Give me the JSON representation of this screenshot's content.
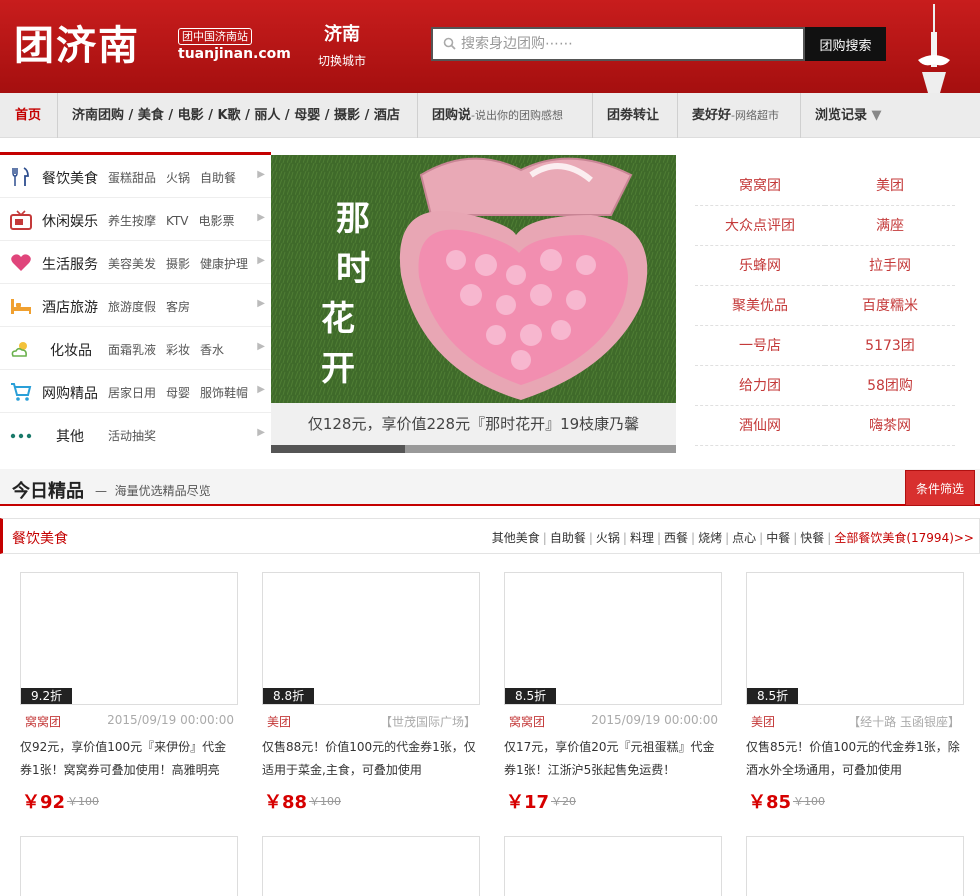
{
  "header": {
    "logo": "团济南",
    "logo_tag": "团中国济南站",
    "logo_domain": "tuanjinan.com",
    "city_name": "济南",
    "city_switch": "切换城市",
    "search_placeholder": "搜索身边团购⋯⋯",
    "search_button": "团购搜索"
  },
  "nav": {
    "home": "首页",
    "jinan_group": "济南团购",
    "food": "美食",
    "movie": "电影",
    "ktv": "K歌",
    "beauty": "丽人",
    "baby": "母婴",
    "photo": "摄影",
    "hotel": "酒店",
    "tuan_say": "团购说",
    "tuan_say_sub": "-说出你的团购感想",
    "coupon_transfer": "团劵转让",
    "maihaohao": "麦好好",
    "maihaohao_sub": "-网络超市",
    "history": "浏览记录"
  },
  "categories": [
    {
      "name": "餐饮美食",
      "links": [
        "蛋糕甜品",
        "火锅",
        "自助餐"
      ]
    },
    {
      "name": "休闲娱乐",
      "links": [
        "养生按摩",
        "KTV",
        "电影票"
      ]
    },
    {
      "name": "生活服务",
      "links": [
        "美容美发",
        "摄影",
        "健康护理"
      ]
    },
    {
      "name": "酒店旅游",
      "links": [
        "旅游度假",
        "客房"
      ]
    },
    {
      "name": "化妆品",
      "links": [
        "面霜乳液",
        "彩妆",
        "香水"
      ]
    },
    {
      "name": "网购精品",
      "links": [
        "居家日用",
        "母婴",
        "服饰鞋帽"
      ]
    },
    {
      "name": "其他",
      "links": [
        "活动抽奖"
      ]
    }
  ],
  "banner": {
    "art_text": "那时花开",
    "caption": "仅128元，享价值228元『那时花开』19枝康乃馨",
    "progress": 0.33
  },
  "sites": [
    "窝窝团",
    "美团",
    "大众点评团",
    "满座",
    "乐蜂网",
    "拉手网",
    "聚美优品",
    "百度糯米",
    "一号店",
    "5173团",
    "给力团",
    "58团购",
    "酒仙网",
    "嗨茶网"
  ],
  "today": {
    "title": "今日精品",
    "subtitle": "海量优选精品尽览",
    "filter_button": "条件筛选"
  },
  "section": {
    "title": "餐饮美食",
    "links": [
      "其他美食",
      "自助餐",
      "火锅",
      "料理",
      "西餐",
      "烧烤",
      "点心",
      "中餐",
      "快餐"
    ],
    "all_link": "全部餐饮美食(17994)>>"
  },
  "deals": [
    {
      "discount": "9.2折",
      "site": "窝窝团",
      "meta": "2015/09/19 00:00:00",
      "desc": "仅92元，享价值100元『来伊份』代金券1张！窝窝券可叠加使用！高雅明亮",
      "price": "￥92",
      "orig": "￥100"
    },
    {
      "discount": "8.8折",
      "site": "美团",
      "meta": "【世茂国际广场】",
      "desc": "仅售88元！价值100元的代金券1张，仅适用于菜金,主食，可叠加使用",
      "price": "￥88",
      "orig": "￥100"
    },
    {
      "discount": "8.5折",
      "site": "窝窝团",
      "meta": "2015/09/19 00:00:00",
      "desc": "仅17元，享价值20元『元祖蛋糕』代金券1张！江浙沪5张起售免运费！",
      "price": "￥17",
      "orig": "￥20"
    },
    {
      "discount": "8.5折",
      "site": "美团",
      "meta": "【经十路 玉函银座】",
      "desc": "仅售85元！价值100元的代金券1张，除酒水外全场通用，可叠加使用",
      "price": "￥85",
      "orig": "￥100"
    }
  ],
  "colors": {
    "brand_red": "#c40000",
    "site_red": "#c43a3a",
    "price_red": "#d60000"
  }
}
